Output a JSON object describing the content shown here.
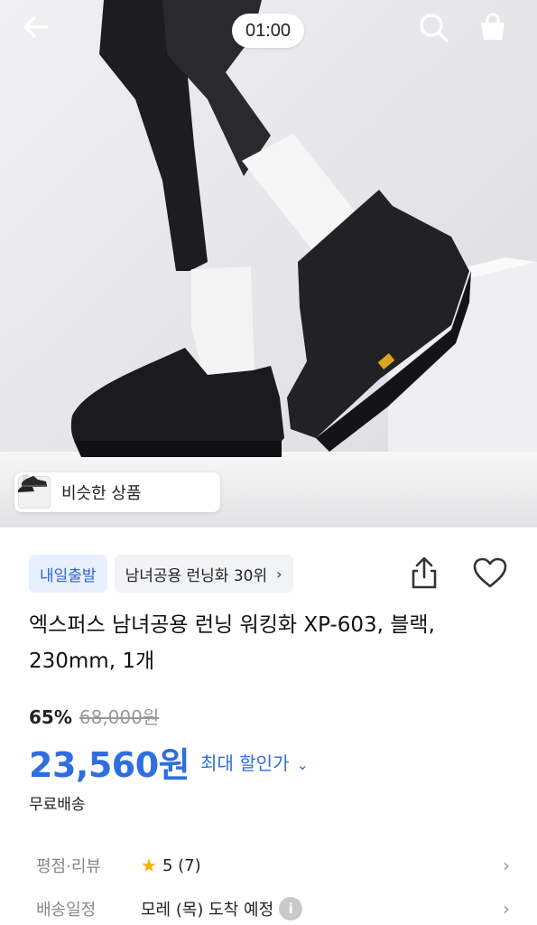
{
  "header": {
    "timer": "01:00",
    "icons": {
      "back": "arrow-left-icon",
      "search": "search-icon",
      "cart": "shopping-bag-icon"
    }
  },
  "hero": {
    "similar_products_label": "비슷한 상품"
  },
  "badges": {
    "express": "내일출발",
    "rank": "남녀공용 런닝화 30위",
    "rank_chevron": "›"
  },
  "actions": {
    "share_icon": "share-icon",
    "wishlist_icon": "heart-icon"
  },
  "product": {
    "title": "엑스퍼스 남녀공용 런닝 워킹화 XP-603, 블랙, 230mm, 1개"
  },
  "price": {
    "discount_rate": "65%",
    "original_price": "68,000원",
    "sale_price": "23,560원",
    "max_discount_label": "최대 할인가",
    "max_discount_chevron": "⌄"
  },
  "shipping_text": "무료배송",
  "info_rows": [
    {
      "label": "평점·리뷰",
      "rating": "5",
      "review_count": "(7)",
      "chevron": "›"
    },
    {
      "label": "배송일정",
      "value": "모레 (목) 도착 예정",
      "info_badge": "i",
      "chevron": "›"
    }
  ],
  "colors": {
    "accent": "#2f6ee0",
    "badge_express_bg": "#e8f0fd",
    "badge_express_text": "#2f62d6",
    "star": "#f6b000"
  }
}
